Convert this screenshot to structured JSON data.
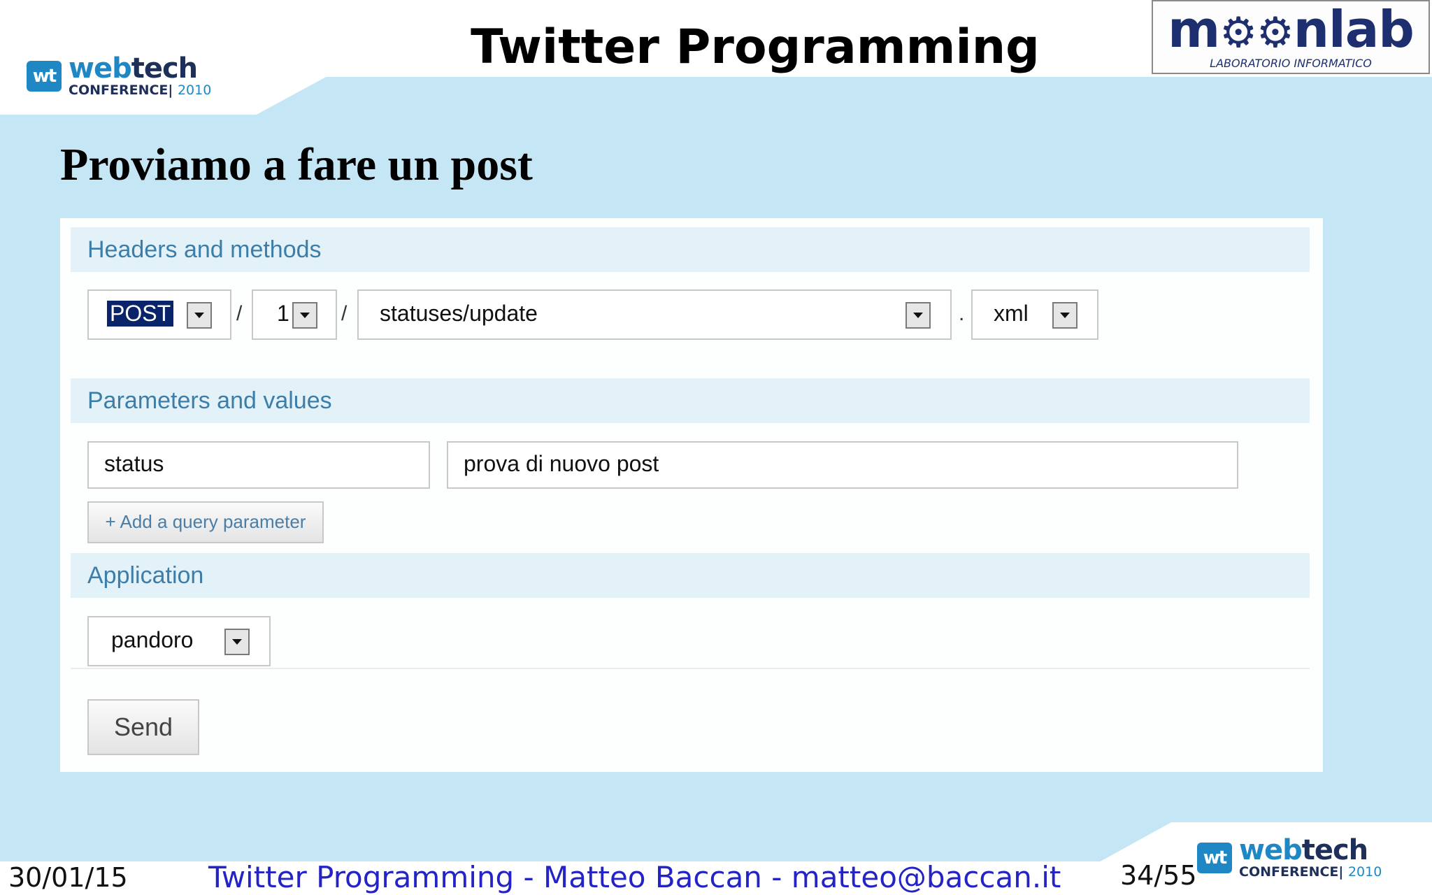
{
  "slide": {
    "title": "Twitter Programming",
    "heading": "Proviamo a fare un post"
  },
  "logos": {
    "webtech_part1": "web",
    "webtech_part2": "tech",
    "webtech_badge": "wt",
    "webtech_sub": "CONFERENCE",
    "webtech_sep": "|",
    "webtech_year": "2010",
    "moonlab_word_start": "m",
    "moonlab_word_end": "nlab",
    "moonlab_sub": "LABORATORIO INFORMATICO"
  },
  "console": {
    "headers_section": "Headers and methods",
    "method": "POST",
    "version": "1",
    "endpoint": "statuses/update",
    "format": "xml",
    "sep_slash": "/",
    "sep_dot": ".",
    "params_section": "Parameters and values",
    "param_name": "status",
    "param_value": "prova di nuovo post",
    "add_param_label": "+ Add a query parameter",
    "application_section": "Application",
    "application_value": "pandoro",
    "send_label": "Send"
  },
  "footer": {
    "date": "30/01/15",
    "center": "Twitter Programming - Matteo Baccan - matteo@baccan.it",
    "page": "34/55"
  },
  "colors": {
    "background": "#c5e6f5",
    "section_header_bg": "#e3f1f8",
    "section_header_text": "#3d7ea8",
    "footer_link": "#2323c6",
    "webtech_blue": "#1f88c4",
    "moonlab_navy": "#1d2f6e"
  }
}
